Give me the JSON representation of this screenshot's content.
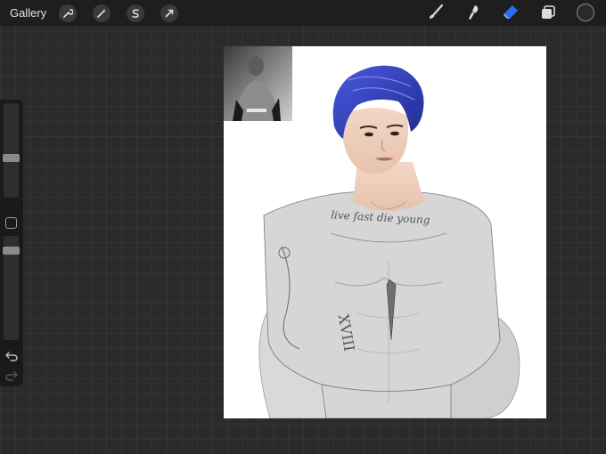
{
  "topbar": {
    "gallery_label": "Gallery",
    "left_tools": [
      {
        "icon": "wrench-icon",
        "name": "actions"
      },
      {
        "icon": "magic-wand-icon",
        "name": "adjustments"
      },
      {
        "icon": "selection-s-icon",
        "name": "selection"
      },
      {
        "icon": "transform-arrow-icon",
        "name": "transform"
      }
    ],
    "right_tools": [
      {
        "icon": "brush-icon",
        "name": "paint"
      },
      {
        "icon": "smudge-icon",
        "name": "smudge"
      },
      {
        "icon": "eraser-icon",
        "name": "erase",
        "active": true
      },
      {
        "icon": "layers-icon",
        "name": "layers"
      }
    ],
    "active_color": "#2a2a2a"
  },
  "sidebar": {
    "brush_size_level": 0.55,
    "opacity_level": 0.15
  },
  "canvas": {
    "tattoo_text": "live fast die young",
    "roman_numeral": "XVIII"
  },
  "colors": {
    "hair": "#2f3fc0",
    "eraser_active": "#2a6cf0"
  }
}
